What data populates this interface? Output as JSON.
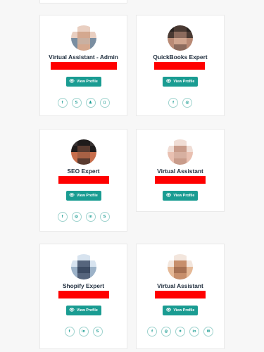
{
  "cards": [
    {
      "title": "Virtual Assistant - Admin",
      "button": "View Profile",
      "socials": [
        "facebook-icon",
        "skype-icon",
        "upwork-icon",
        "phone-icon"
      ],
      "avatar_palette": [
        "#e9cfc1",
        "#d4a88f",
        "#7a8ea1",
        "#ffffff",
        "#c9b0a1"
      ]
    },
    {
      "title": "QuickBooks Expert",
      "button": "View Profile",
      "socials": [
        "facebook-icon",
        "instagram-icon"
      ],
      "avatar_palette": [
        "#4a3a33",
        "#8c6b5d",
        "#b98a75",
        "#2b2421",
        "#cfa48e"
      ]
    },
    {
      "title": "SEO Expert",
      "button": "View Profile",
      "socials": [
        "facebook-icon",
        "instagram-icon",
        "linkedin-icon",
        "skype-icon"
      ],
      "avatar_palette": [
        "#1f1b1b",
        "#5a3b30",
        "#c76e4c",
        "#383232",
        "#a86145"
      ]
    },
    {
      "title": "Virtual Assistant",
      "button": "View Profile",
      "socials": [],
      "avatar_palette": [
        "#f0ddd5",
        "#c99c8b",
        "#e9c0b1",
        "#ffffff",
        "#d7b0a1"
      ]
    },
    {
      "title": "Shopify Expert",
      "button": "View Profile",
      "socials": [
        "facebook-icon",
        "linkedin-icon",
        "skype-icon"
      ],
      "avatar_palette": [
        "#d7e3ef",
        "#56657d",
        "#9cb2c8",
        "#ffffff",
        "#3c4b63"
      ]
    },
    {
      "title": "Virtual Assistant",
      "button": "View Profile",
      "socials": [
        "facebook-icon",
        "instagram-icon",
        "twitter-icon",
        "linkedin-icon",
        "email-icon"
      ],
      "avatar_palette": [
        "#f3e6dd",
        "#c78f6c",
        "#e5b997",
        "#ffffff",
        "#a77153"
      ]
    }
  ],
  "colors": {
    "accent": "#1a9c92",
    "redaction": "#ff0000",
    "title": "#1f2d3d"
  }
}
